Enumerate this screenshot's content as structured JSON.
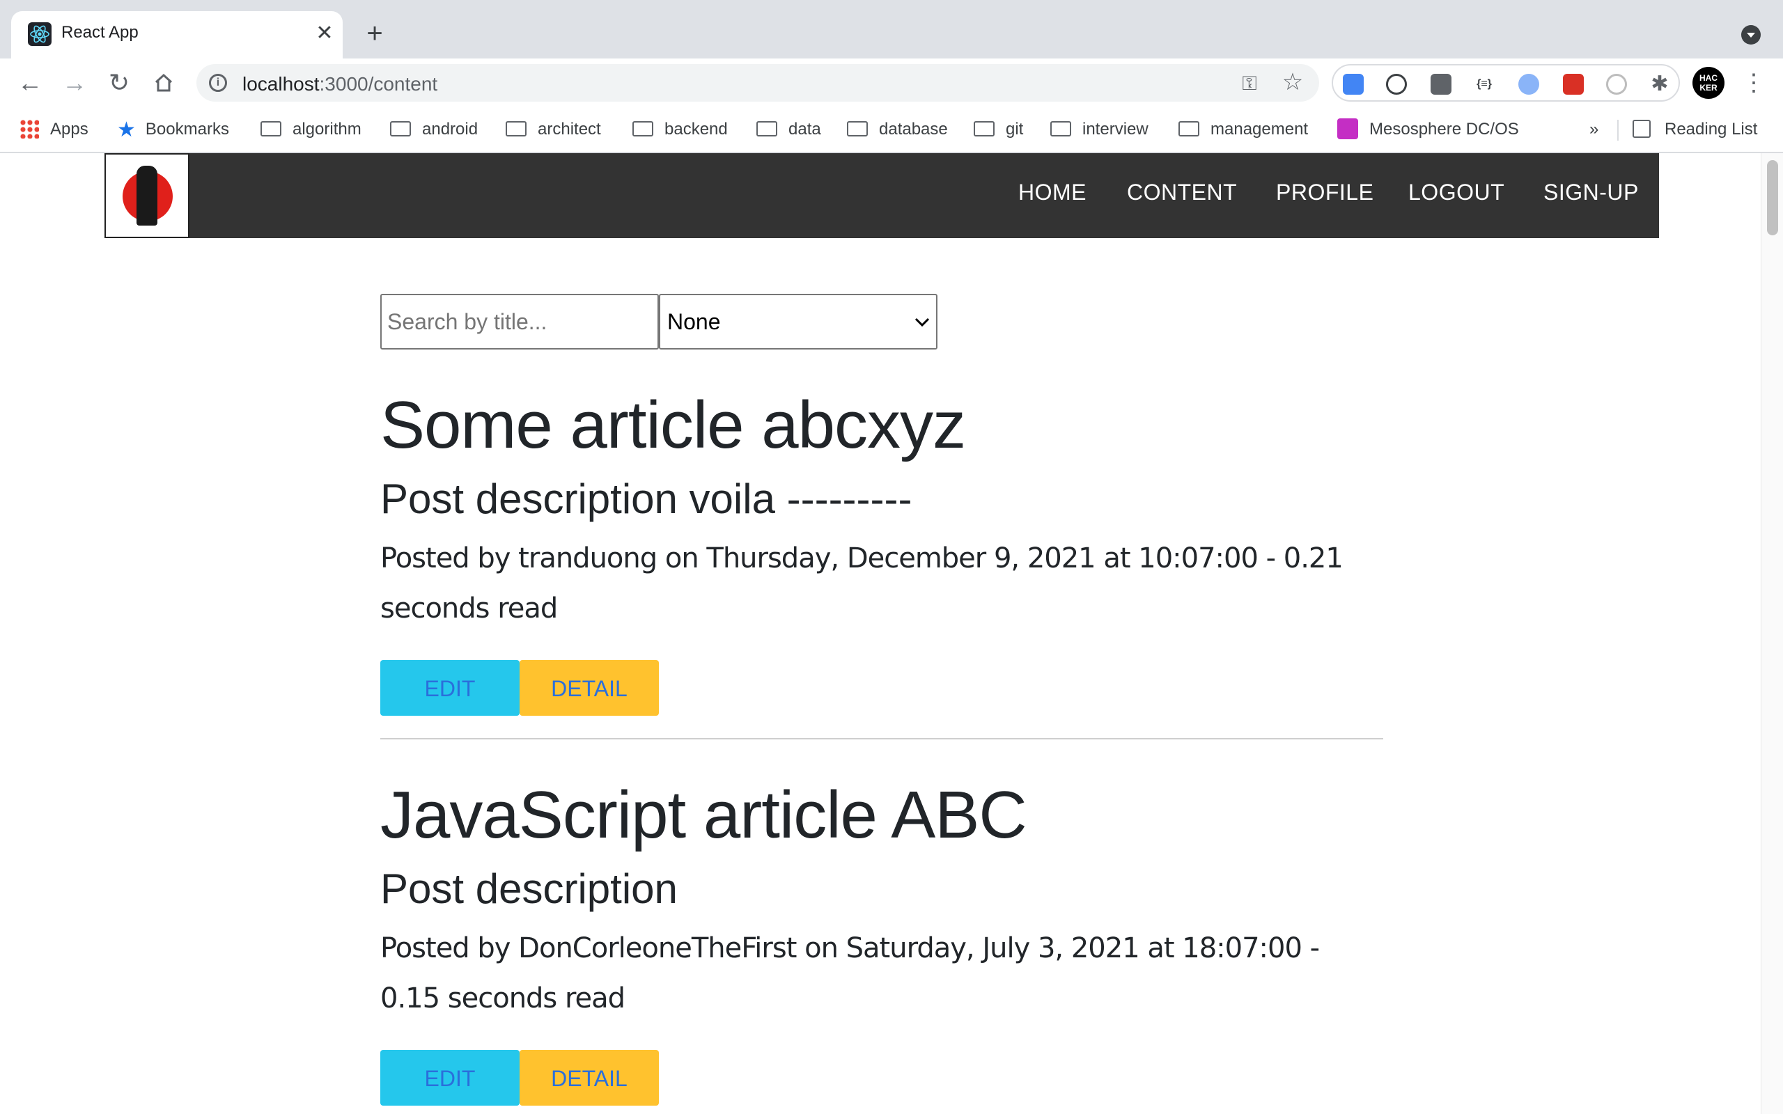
{
  "browser": {
    "tab_title": "React App",
    "url_host": "localhost",
    "url_path": ":3000/content",
    "bookmarks": [
      {
        "label": "Apps",
        "icon": "apps-grid-icon"
      },
      {
        "label": "Bookmarks",
        "icon": "star-icon"
      },
      {
        "label": "algorithm",
        "icon": "folder-icon"
      },
      {
        "label": "android",
        "icon": "folder-icon"
      },
      {
        "label": "architect",
        "icon": "folder-icon"
      },
      {
        "label": "backend",
        "icon": "folder-icon"
      },
      {
        "label": "data",
        "icon": "folder-icon"
      },
      {
        "label": "database",
        "icon": "folder-icon"
      },
      {
        "label": "git",
        "icon": "folder-icon"
      },
      {
        "label": "interview",
        "icon": "folder-icon"
      },
      {
        "label": "management",
        "icon": "folder-icon"
      },
      {
        "label": "Mesosphere DC/OS",
        "icon": "mesosphere-icon"
      }
    ],
    "overflow_label": "»",
    "reading_list": "Reading List",
    "avatar_text": "HAC KER"
  },
  "nav": {
    "links": [
      "HOME",
      "CONTENT",
      "PROFILE",
      "LOGOUT",
      "SIGN-UP"
    ]
  },
  "search": {
    "placeholder": "Search by title...",
    "filter_value": "None"
  },
  "articles": [
    {
      "title": "Some article abcxyz",
      "description": "Post description voila ---------",
      "meta": "Posted by tranduong on Thursday, December 9, 2021 at 10:07:00 - 0.21 seconds read",
      "edit_label": "EDIT",
      "detail_label": "DETAIL"
    },
    {
      "title": "JavaScript article ABC",
      "description": "Post description",
      "meta": "Posted by DonCorleoneTheFirst on Saturday, July 3, 2021 at 18:07:00 - 0.15 seconds read",
      "edit_label": "EDIT",
      "detail_label": "DETAIL"
    }
  ],
  "colors": {
    "nav_bg": "#333333",
    "edit_button": "#25c7ec",
    "detail_button": "#ffc22e",
    "button_text": "#2a6fdb"
  }
}
